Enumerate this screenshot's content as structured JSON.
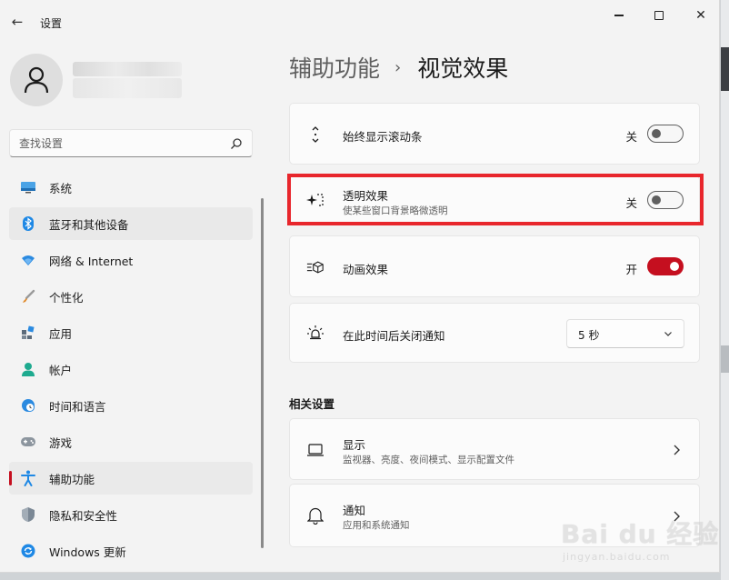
{
  "window": {
    "back_glyph": "←",
    "title": "设置",
    "close_glyph": "✕"
  },
  "search": {
    "placeholder": "查找设置"
  },
  "sidebar": {
    "items": [
      {
        "label": "系统",
        "icon": "monitor-icon"
      },
      {
        "label": "蓝牙和其他设备",
        "icon": "bluetooth-icon"
      },
      {
        "label": "网络 & Internet",
        "icon": "wifi-icon"
      },
      {
        "label": "个性化",
        "icon": "brush-icon"
      },
      {
        "label": "应用",
        "icon": "apps-icon"
      },
      {
        "label": "帐户",
        "icon": "person-icon"
      },
      {
        "label": "时间和语言",
        "icon": "globe-clock-icon"
      },
      {
        "label": "游戏",
        "icon": "gamepad-icon"
      },
      {
        "label": "辅助功能",
        "icon": "accessibility-icon",
        "selected": true
      },
      {
        "label": "隐私和安全性",
        "icon": "shield-icon"
      },
      {
        "label": "Windows 更新",
        "icon": "update-icon"
      }
    ]
  },
  "breadcrumb": {
    "parent": "辅助功能",
    "separator": "›",
    "current": "视觉效果"
  },
  "settings": {
    "scrollbars": {
      "title": "始终显示滚动条",
      "state": "关",
      "on": false
    },
    "transparency": {
      "title": "透明效果",
      "subtitle": "使某些窗口背景略微透明",
      "state": "关",
      "on": false
    },
    "animation": {
      "title": "动画效果",
      "state": "开",
      "on": true
    },
    "dismiss": {
      "title": "在此时间后关闭通知",
      "value": "5 秒"
    }
  },
  "related": {
    "title": "相关设置",
    "display": {
      "title": "显示",
      "subtitle": "监视器、亮度、夜间模式、显示配置文件"
    },
    "notifications": {
      "title": "通知",
      "subtitle": "应用和系统通知"
    }
  },
  "colors": {
    "accent": "#c50f1f",
    "highlight_box": "#e8262c",
    "background": "#f3f3f3"
  },
  "watermark": {
    "main": "Bai du 经验",
    "sub": "jingyan.baidu.com"
  }
}
